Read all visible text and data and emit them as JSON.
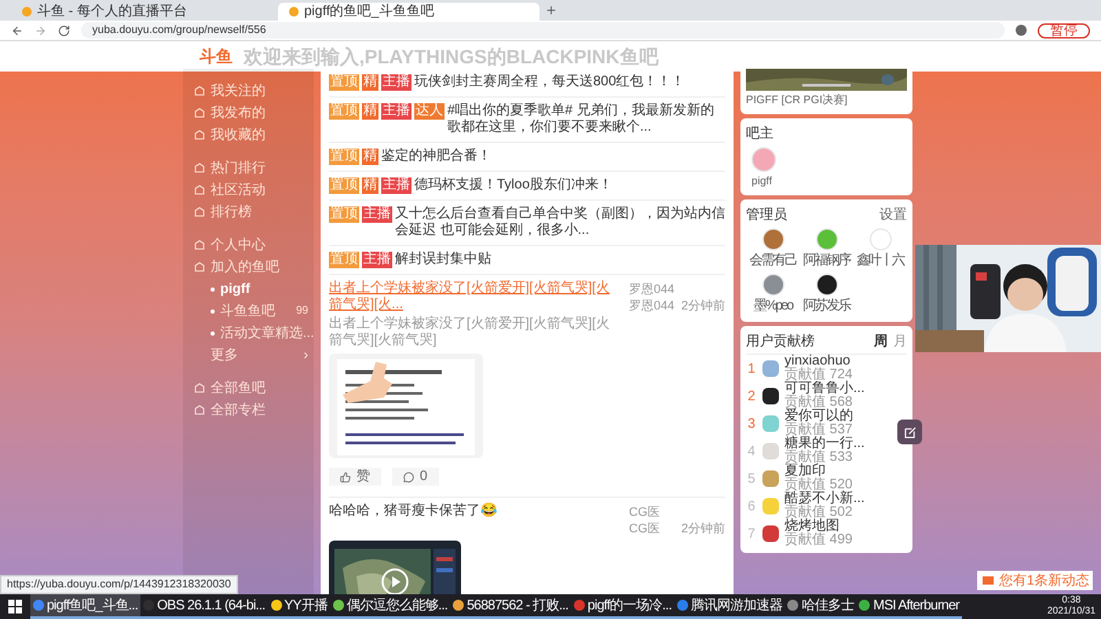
{
  "browser": {
    "tabs": [
      {
        "title": "斗鱼 - 每个人的直播平台",
        "selected": false
      },
      {
        "title": "pigff的鱼吧_斗鱼鱼吧",
        "selected": true
      }
    ],
    "url": "yuba.douyu.com/group/newself/556",
    "profile_button": "暂停"
  },
  "banner": {
    "logo": "斗鱼",
    "title": "欢迎来到输入,PLAYTHINGS的BLACKPINK鱼吧"
  },
  "sidebar": {
    "items": [
      {
        "label": "我关注的",
        "selected": false
      },
      {
        "label": "我发布的",
        "selected": false
      },
      {
        "label": "我收藏的",
        "selected": false
      },
      {
        "label": "热门排行",
        "selected": false
      },
      {
        "label": "社区活动",
        "selected": false
      },
      {
        "label": "排行榜",
        "selected": false
      },
      {
        "label": "个人中心",
        "selected": false
      },
      {
        "label": "加入的鱼吧",
        "selected": false,
        "children": [
          {
            "label": "pigff",
            "selected": true
          },
          {
            "label": "斗鱼鱼吧",
            "badge": "99",
            "selected": false
          },
          {
            "label": "活动文章精选...",
            "selected": false
          }
        ]
      },
      {
        "label": "更多",
        "more": "›",
        "selected": false
      },
      {
        "label": "全部鱼吧",
        "selected": false
      },
      {
        "label": "全部专栏",
        "selected": false
      }
    ]
  },
  "pinned_posts": [
    {
      "tags": [
        {
          "text": "置顶",
          "color": "#f39a3c"
        },
        {
          "text": "精",
          "color": "#f26a2e"
        },
        {
          "text": "主播",
          "color": "#e8474a"
        }
      ],
      "title": "玩侠剑封主赛周全程，每天送800红包！！！"
    },
    {
      "tags": [
        {
          "text": "置顶",
          "color": "#f39a3c"
        },
        {
          "text": "精",
          "color": "#f26a2e"
        },
        {
          "text": "主播",
          "color": "#e8474a"
        },
        {
          "text": "达人",
          "color": "#f07a30"
        }
      ],
      "title": "#唱出你的夏季歌单# 兄弟们，我最新发新的歌都在这里，你们要不要来瞅个..."
    },
    {
      "tags": [
        {
          "text": "置顶",
          "color": "#f39a3c"
        },
        {
          "text": "精",
          "color": "#f26a2e"
        }
      ],
      "title": "鉴定的神肥合番！"
    },
    {
      "tags": [
        {
          "text": "置顶",
          "color": "#f39a3c"
        },
        {
          "text": "精",
          "color": "#f26a2e"
        },
        {
          "text": "主播",
          "color": "#e8474a"
        }
      ],
      "title": "德玛杯支援！Tyloo股东们冲来！"
    },
    {
      "tags": [
        {
          "text": "置顶",
          "color": "#f39a3c"
        },
        {
          "text": "主播",
          "color": "#e8474a"
        }
      ],
      "title": "又十怎么后台查看自己单合中奖（副图），因为站内信会延迟 也可能会延刚，很多小..."
    },
    {
      "tags": [
        {
          "text": "置顶",
          "color": "#f39a3c"
        },
        {
          "text": "主播",
          "color": "#e8474a"
        }
      ],
      "title": "解封误封集中贴"
    }
  ],
  "posts": [
    {
      "title": "出者上个学妹被家没了[火箭爱开][火箭气哭][火箭气哭][火...",
      "highlight": true,
      "summary": "出者上个学妹被家没了[火箭爱开][火箭气哭][火箭气哭][火箭气哭]",
      "author": "罗恩044",
      "replier": "罗恩044",
      "time": "2分钟前",
      "likes": "赞",
      "comments": "0"
    },
    {
      "kind": "video",
      "title": "哈哈哈，猪哥瘦卡保苦了😂",
      "highlight": false,
      "author": "CG医",
      "replier": "CG医",
      "time": "2分钟前"
    }
  ],
  "right": {
    "cover_caption": "PIGFF [CR PGI决赛]",
    "owner": {
      "title": "吧主",
      "name": "pigff"
    },
    "admins": {
      "title": "管理员",
      "action": "设置",
      "members": [
        {
          "name": "会需有己",
          "color": "#b0703a"
        },
        {
          "name": "阿福钢序",
          "color": "#5bbf3a"
        },
        {
          "name": "鑫叶丨六",
          "color": "#ffffff"
        },
        {
          "name": "墨%peo",
          "color": "#8a8f96"
        },
        {
          "name": "阿苏发乐",
          "color": "#1e1e1e"
        }
      ]
    },
    "ranking": {
      "title": "用户贡献榜",
      "tabs": [
        {
          "label": "周",
          "selected": true
        },
        {
          "label": "月",
          "selected": false
        }
      ],
      "rows": [
        {
          "rank": "1",
          "name": "yinxiaohuo",
          "score": "贡献值 724",
          "color": "#8fb3d9"
        },
        {
          "rank": "2",
          "name": "可可鲁鲁小...",
          "score": "贡献值 568",
          "color": "#222222"
        },
        {
          "rank": "3",
          "name": "爱你可以的",
          "score": "贡献值 537",
          "color": "#7fd3d0"
        },
        {
          "rank": "4",
          "name": "糖果的一行...",
          "score": "贡献值 533",
          "color": "#e0dcd8"
        },
        {
          "rank": "5",
          "name": "夏加印",
          "score": "贡献值 520",
          "color": "#c9a35a"
        },
        {
          "rank": "6",
          "name": "酷瑟不小新...",
          "score": "贡献值 502",
          "color": "#f5d23c"
        },
        {
          "rank": "7",
          "name": "烧烤地图",
          "score": "贡献值 499",
          "color": "#d23a3a"
        }
      ]
    }
  },
  "notice": "您有1条新动态",
  "status_url": "https://yuba.douyu.com/p/1443912318320030",
  "taskbar": {
    "apps": [
      {
        "label": "pigff鱼吧_斗鱼...",
        "color": "#4285f4",
        "selected": true
      },
      {
        "label": "OBS 26.1.1 (64-bi...",
        "color": "#302e31",
        "selected": false
      },
      {
        "label": "YY开播",
        "color": "#f5c518",
        "selected": false
      },
      {
        "label": "偶尔逗您么能够...",
        "color": "#6cc24a",
        "selected": false
      },
      {
        "label": "56887562 - 打败...",
        "color": "#e9a23b",
        "selected": false
      },
      {
        "label": "pigff的一场冷...",
        "color": "#d9342b",
        "selected": false
      },
      {
        "label": "腾讯网游加速器",
        "color": "#2b7de9",
        "selected": false
      },
      {
        "label": "哈佳多士",
        "color": "#888888",
        "selected": false
      },
      {
        "label": "MSI Afterburner",
        "color": "#3cb043",
        "selected": false
      }
    ],
    "time": "0:38",
    "date": "2021/10/31"
  }
}
